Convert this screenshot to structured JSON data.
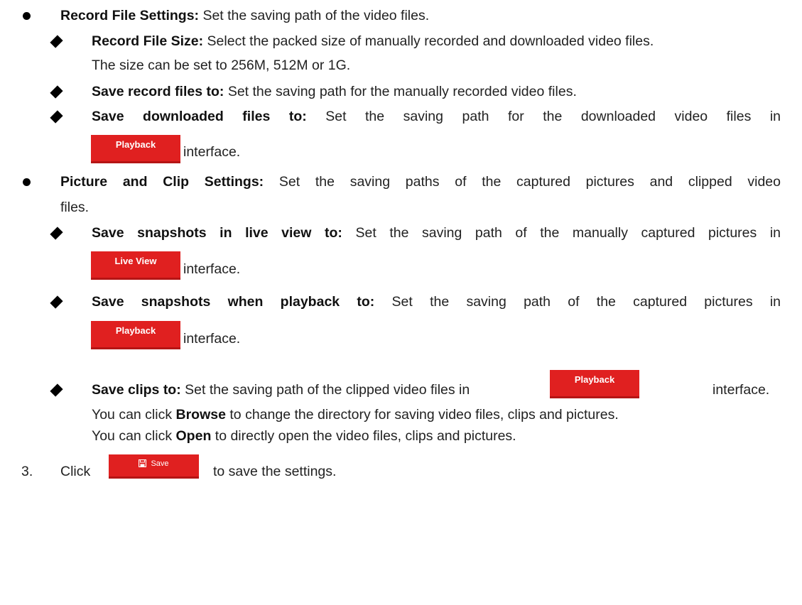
{
  "colors": {
    "button_red": "#e02020",
    "text": "#222222"
  },
  "sections": {
    "record_file": {
      "title": "Record File Settings:",
      "text": " Set the saving path of the video files.",
      "items": [
        {
          "title": "Record File Size:",
          "text": " Select the packed size of manually recorded and downloaded video files.",
          "text2": "The size can be set to 256M, 512M or 1G."
        },
        {
          "title": "Save record files to:",
          "text": " Set the saving path for the manually recorded video files."
        },
        {
          "title": "Save downloaded files to:",
          "text": " Set the saving path for the downloaded video files in",
          "button": "Playback",
          "after": "interface."
        }
      ]
    },
    "picture_clip": {
      "title": "Picture and Clip Settings:",
      "text": " Set the saving paths of the captured pictures and clipped video",
      "text2": "files.",
      "items": [
        {
          "title": "Save snapshots in live view to:",
          "text": " Set the saving path of the manually captured pictures in",
          "button": "Live View",
          "after": "interface."
        },
        {
          "title": "Save snapshots when playback to:",
          "text": " Set the saving path of the captured pictures in",
          "button": "Playback",
          "after": "interface."
        },
        {
          "title": "Save clips to:",
          "text": " Set the saving path of the clipped video files in",
          "button": "Playback",
          "after": "interface."
        }
      ]
    }
  },
  "notes": {
    "browse_pre": "You can click ",
    "browse_word": "Browse",
    "browse_post": " to change the directory for saving video files, clips and pictures.",
    "open_pre": "You can click ",
    "open_word": "Open",
    "open_post": " to directly open the video files, clips and pictures."
  },
  "step": {
    "number": "3.",
    "click": "Click",
    "button": "Save",
    "after": "to save the settings."
  }
}
